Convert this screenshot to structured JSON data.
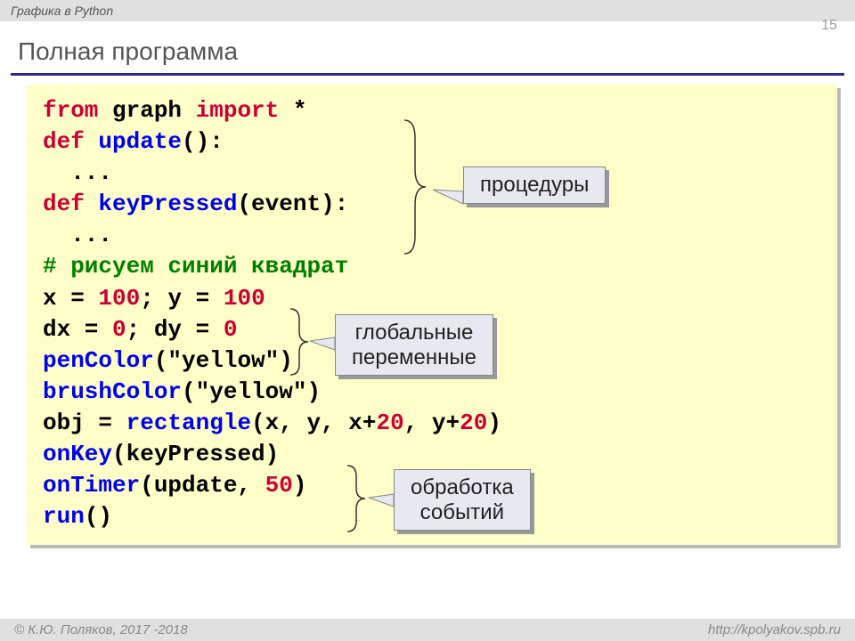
{
  "header": {
    "subject": "Графика в Python"
  },
  "pageNumber": "15",
  "title": "Полная программа",
  "code": {
    "l1_from": "from",
    "l1_mod": " graph ",
    "l1_import": "import",
    "l1_star": " *",
    "l2_def": "def",
    "l2_fn": " update",
    "l2_paren": "():",
    "l3_dots": "  ...",
    "l4_def": "def",
    "l4_fn": " keyPressed",
    "l4_args": "(event):",
    "l5_dots": "  ...",
    "l6_comment": "# рисуем синий квадрат",
    "l7a": "x = ",
    "l7n1": "100",
    "l7b": "; y = ",
    "l7n2": "100",
    "l8a": "dx = ",
    "l8n1": "0",
    "l8b": "; dy = ",
    "l8n2": "0",
    "l9_fn": "penColor",
    "l9_arg": "(\"yellow\")",
    "l10_fn": "brushColor",
    "l10_arg": "(\"yellow\")",
    "l11a": "obj = ",
    "l11_fn": "rectangle",
    "l11b": "(x, y, x+",
    "l11n1": "20",
    "l11c": ", y+",
    "l11n2": "20",
    "l11d": ")",
    "l12_fn": "onKey",
    "l12_arg": "(keyPressed)",
    "l13_fn": "onTimer",
    "l13a": "(update, ",
    "l13n": "50",
    "l13b": ")",
    "l14_fn": "run",
    "l14_arg": "()"
  },
  "callouts": {
    "c1": "процедуры",
    "c2a": "глобальные",
    "c2b": "переменные",
    "c3a": "обработка",
    "c3b": "событий"
  },
  "footer": {
    "left": "© К.Ю. Поляков, 2017 -2018",
    "right": "http://kpolyakov.spb.ru"
  }
}
